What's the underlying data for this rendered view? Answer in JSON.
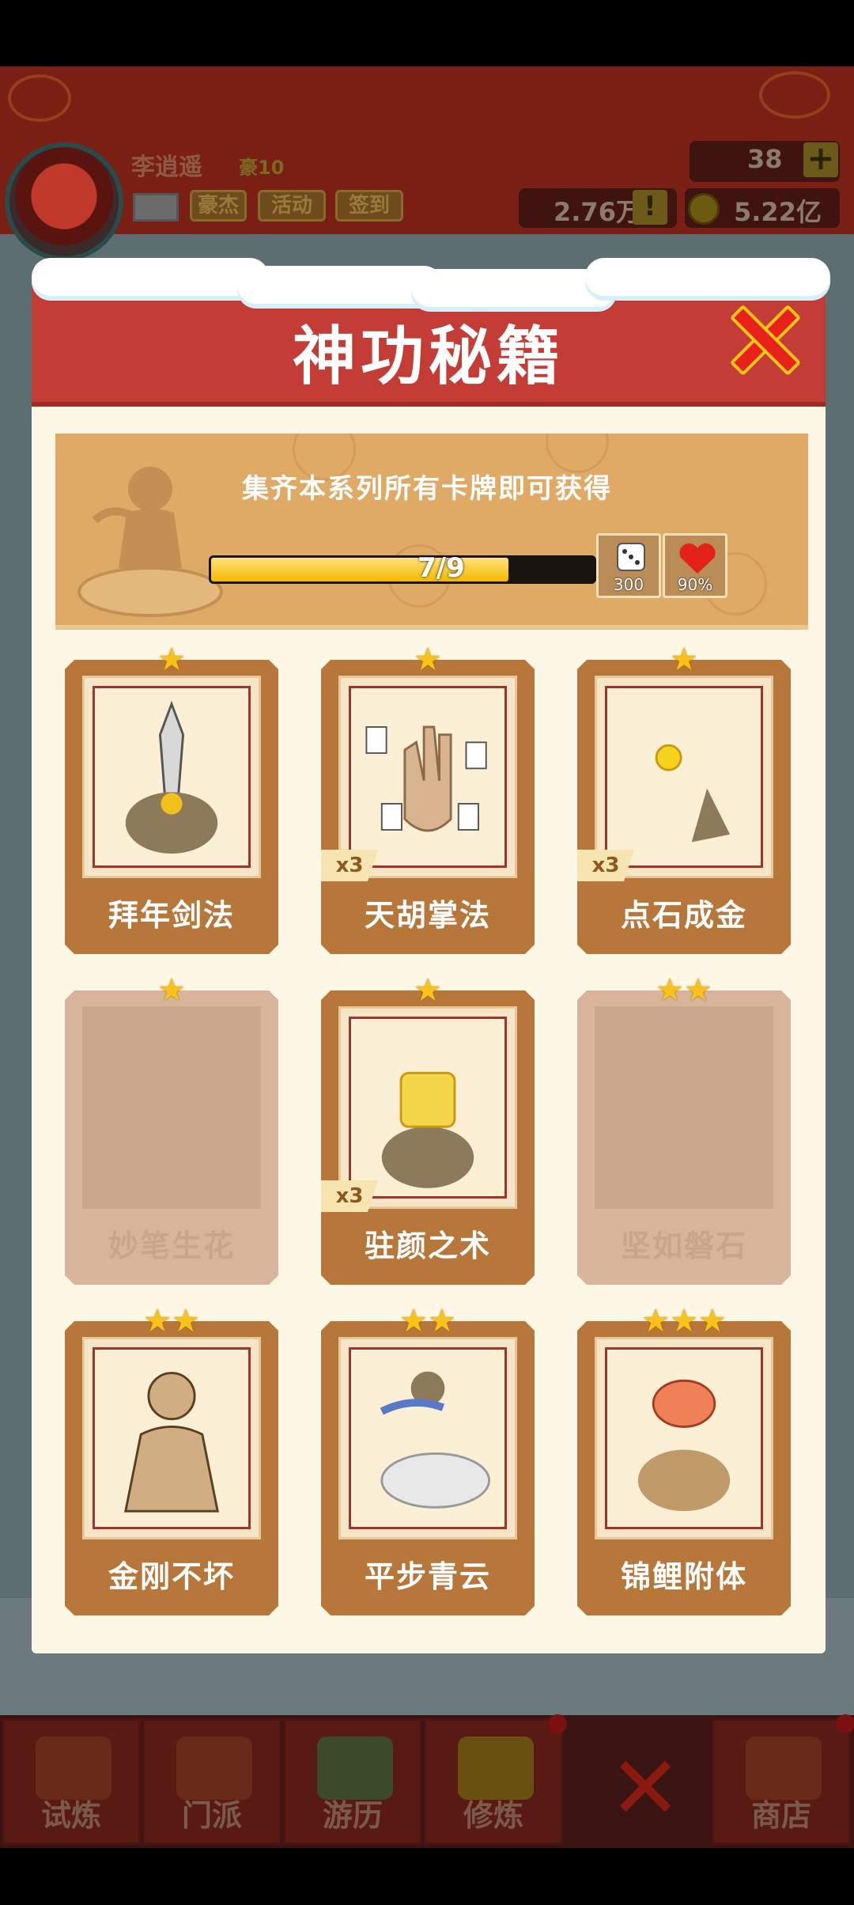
{
  "header": {
    "player_name": "李逍遥",
    "vip_label": "豪10",
    "buttons": [
      "豪杰",
      "活动",
      "签到"
    ],
    "gems": "38",
    "resource1": "2.76万",
    "coins": "5.22亿"
  },
  "modal": {
    "title": "神功秘籍",
    "banner_text": "集齐本系列所有卡牌即可获得",
    "progress": {
      "collected": 7,
      "total": 9,
      "label": "7/9"
    },
    "rewards": [
      {
        "icon": "dice-icon",
        "label": "300"
      },
      {
        "icon": "heart-icon",
        "label": "90%"
      }
    ],
    "cards": [
      {
        "name": "拜年剑法",
        "stars": 1,
        "count": "",
        "locked": false,
        "icon": "sword-icon"
      },
      {
        "name": "天胡掌法",
        "stars": 1,
        "count": "x3",
        "locked": false,
        "icon": "palm-icon"
      },
      {
        "name": "点石成金",
        "stars": 1,
        "count": "x3",
        "locked": false,
        "icon": "gold-finger-icon"
      },
      {
        "name": "妙笔生花",
        "stars": 1,
        "count": "",
        "locked": true,
        "icon": ""
      },
      {
        "name": "驻颜之术",
        "stars": 1,
        "count": "x3",
        "locked": false,
        "icon": "face-mask-icon"
      },
      {
        "name": "坚如磐石",
        "stars": 2,
        "count": "",
        "locked": true,
        "icon": ""
      },
      {
        "name": "金刚不坏",
        "stars": 2,
        "count": "",
        "locked": false,
        "icon": "muscle-man-icon"
      },
      {
        "name": "平步青云",
        "stars": 2,
        "count": "",
        "locked": false,
        "icon": "cloud-rider-icon"
      },
      {
        "name": "锦鲤附体",
        "stars": 3,
        "count": "",
        "locked": false,
        "icon": "koi-icon"
      }
    ]
  },
  "bottom_nav": [
    {
      "label": "试炼"
    },
    {
      "label": "门派"
    },
    {
      "label": "游历"
    },
    {
      "label": "修炼"
    },
    {
      "label": "商店"
    }
  ],
  "colors": {
    "header_red": "#c33d36",
    "card_brown": "#b7763a",
    "star": "#f8c21a",
    "close": "#e8211b"
  }
}
